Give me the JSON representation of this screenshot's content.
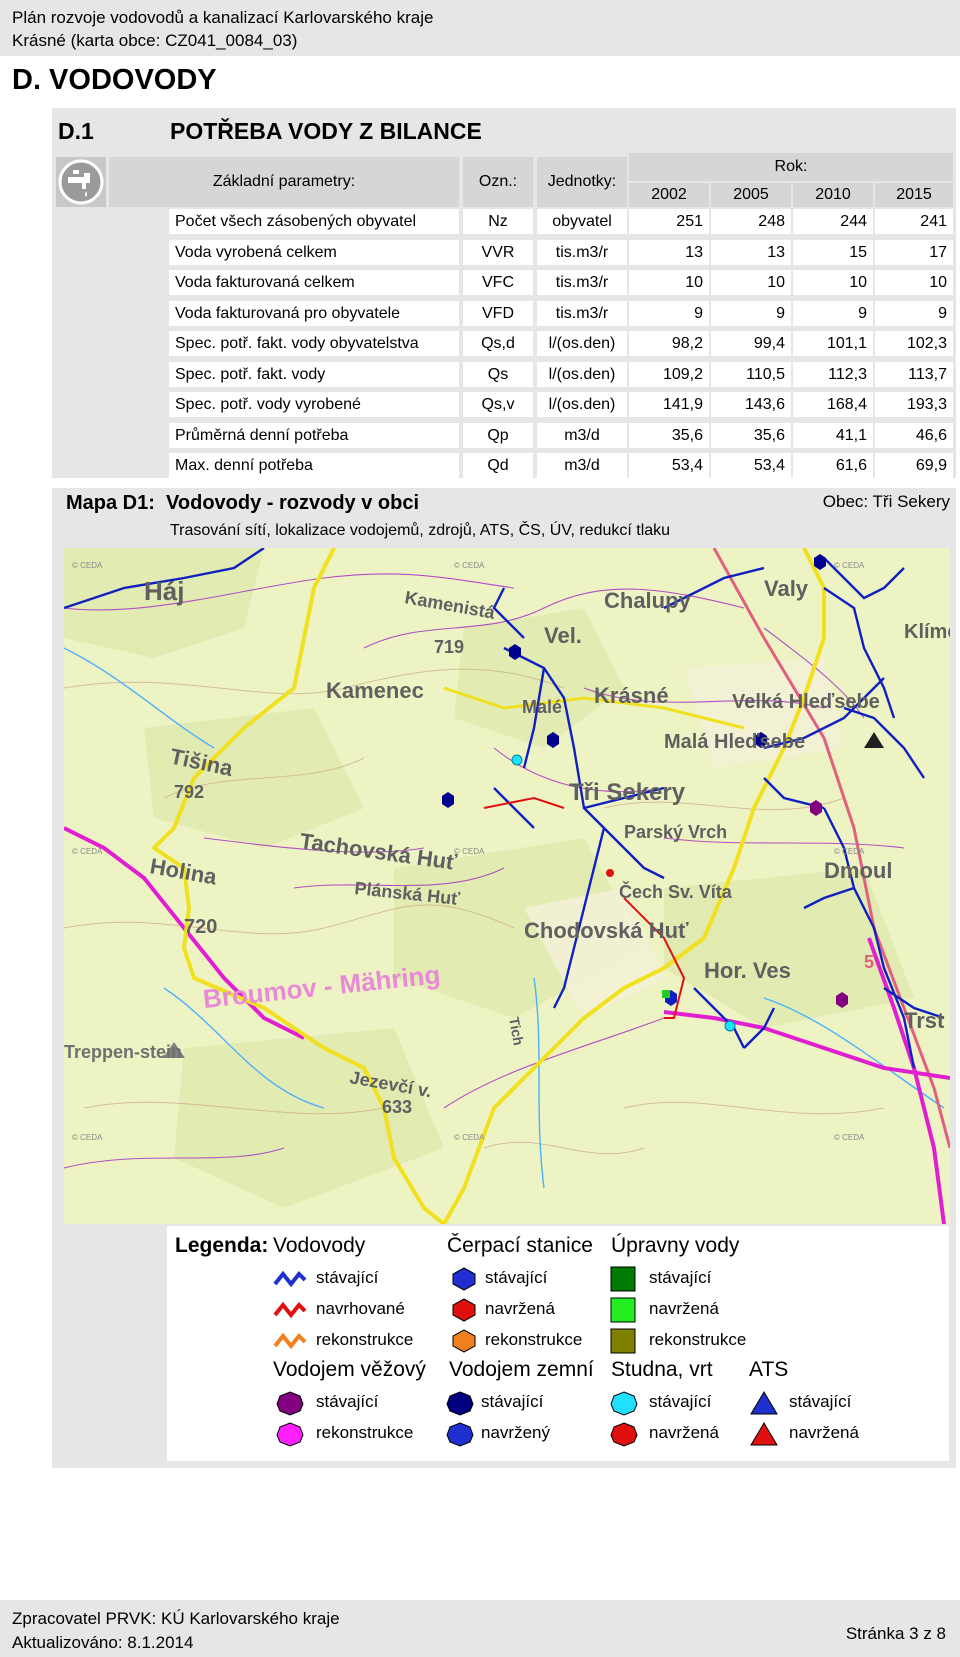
{
  "header": {
    "line1": "Plán rozvoje vodovodů a kanalizací Karlovarského kraje",
    "line2": "Krásné (karta obce: CZ041_0084_03)"
  },
  "section_title": "D. VODOVODY",
  "table": {
    "number": "D.1",
    "title": "POTŘEBA VODY Z BILANCE",
    "col_param": "Základní parametry:",
    "col_ozn": "Ozn.:",
    "col_unit": "Jednotky:",
    "col_year": "Rok:",
    "years": [
      "2002",
      "2005",
      "2010",
      "2015"
    ],
    "rows": [
      {
        "name": "Počet všech zásobených obyvatel",
        "ozn": "Nz",
        "unit": "obyvatel",
        "values": [
          "251",
          "248",
          "244",
          "241"
        ]
      },
      {
        "name": "Voda vyrobená celkem",
        "ozn": "VVR",
        "unit": "tis.m3/r",
        "values": [
          "13",
          "13",
          "15",
          "17"
        ]
      },
      {
        "name": "Voda fakturovaná celkem",
        "ozn": "VFC",
        "unit": "tis.m3/r",
        "values": [
          "10",
          "10",
          "10",
          "10"
        ]
      },
      {
        "name": "Voda fakturovaná pro obyvatele",
        "ozn": "VFD",
        "unit": "tis.m3/r",
        "values": [
          "9",
          "9",
          "9",
          "9"
        ]
      },
      {
        "name": "Spec. potř. fakt. vody obyvatelstva",
        "ozn": "Qs,d",
        "unit": "l/(os.den)",
        "values": [
          "98,2",
          "99,4",
          "101,1",
          "102,3"
        ]
      },
      {
        "name": "Spec. potř. fakt. vody",
        "ozn": "Qs",
        "unit": "l/(os.den)",
        "values": [
          "109,2",
          "110,5",
          "112,3",
          "113,7"
        ]
      },
      {
        "name": "Spec. potř. vody vyrobené",
        "ozn": "Qs,v",
        "unit": "l/(os.den)",
        "values": [
          "141,9",
          "143,6",
          "168,4",
          "193,3"
        ]
      },
      {
        "name": "Průměrná denní potřeba",
        "ozn": "Qp",
        "unit": "m3/d",
        "values": [
          "35,6",
          "35,6",
          "41,1",
          "46,6"
        ]
      },
      {
        "name": "Max. denní potřeba",
        "ozn": "Qd",
        "unit": "m3/d",
        "values": [
          "53,4",
          "53,4",
          "61,6",
          "69,9"
        ]
      }
    ]
  },
  "map": {
    "title_prefix": "Mapa D1:",
    "title": "Vodovody - rozvody v obci",
    "subtitle": "Trasování sítí, lokalizace vodojemů, zdrojů, ATS, ČS, ÚV, redukcí tlaku",
    "obec": "Obec: Tři Sekery",
    "watermark": "© CEDA",
    "labels": [
      "Háj",
      "Kamenec",
      "Tišina",
      "792",
      "Holina",
      "720",
      "Tachovská Huť",
      "Plánská Huť",
      "Chodovská Huť",
      "Tři Sekery",
      "Krásné",
      "Velká Hleďsebe",
      "Malá Hleďsebe",
      "Valy",
      "Chalupy",
      "Dmoul",
      "Hor. Ves",
      "Čech Sv. Víta",
      "Parský Vrch",
      "Jezevčí v.",
      "633",
      "719",
      "Broumov - Mähring",
      "Treppen-stein",
      "Vel.",
      "Malé",
      "Kamenistá",
      "Tich",
      "Trst",
      "5",
      "Klíme"
    ]
  },
  "legend": {
    "title": "Legenda:",
    "groups": {
      "vodovody": "Vodovody",
      "cerpaci": "Čerpací stanice",
      "upravny": "Úpravny vody",
      "vezovy": "Vodojem věžový",
      "zemni": "Vodojem zemní",
      "studna": "Studna, vrt",
      "ats": "ATS"
    },
    "items": {
      "vod_stav": "stávající",
      "vod_navrh": "navrhované",
      "vod_rek": "rekonstrukce",
      "cs_stav": "stávající",
      "cs_navrz": "navržená",
      "cs_rek": "rekonstrukce",
      "uv_stav": "stávající",
      "uv_navrz": "navržená",
      "uv_rek": "rekonstrukce",
      "vv_stav": "stávající",
      "vv_rek": "rekonstrukce",
      "vz_stav": "stávající",
      "vz_navrz": "navržený",
      "st_stav": "stávající",
      "st_navrz": "navržená",
      "ats_stav": "stávající",
      "ats_navrz": "navržená"
    },
    "colors": {
      "blue": "#1f2fd0",
      "red": "#e01010",
      "orange": "#f08020",
      "dark_green": "#007a00",
      "light_green": "#22ee22",
      "olive": "#808000",
      "purple": "#800080",
      "magenta": "#ff20ff",
      "navy": "#000080",
      "cyan": "#20e0ff"
    }
  },
  "footer": {
    "line1": "Zpracovatel PRVK: KÚ Karlovarského kraje",
    "line2": "Aktualizováno: 8.1.2014",
    "page": "Stránka 3 z 8"
  }
}
